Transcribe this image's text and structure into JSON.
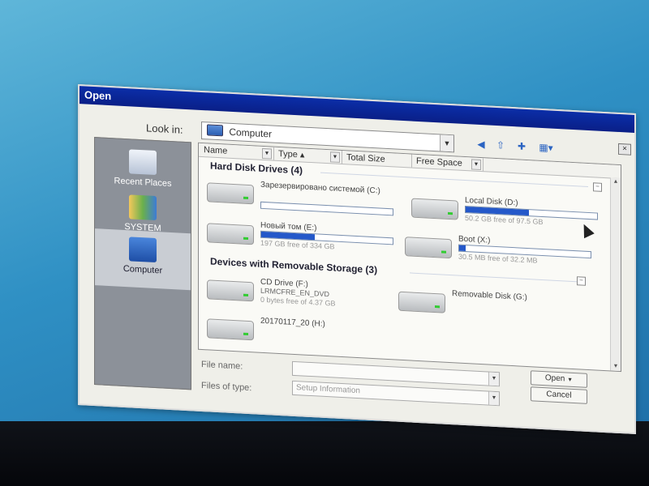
{
  "window": {
    "title": "Open",
    "close_glyph": "×"
  },
  "toolbar": {
    "lookin_label": "Look in:",
    "lookin_value": "Computer",
    "icons": [
      "back-icon",
      "up-folder-icon",
      "new-folder-icon",
      "views-icon"
    ]
  },
  "places": [
    {
      "label": "Recent Places"
    },
    {
      "label": "SYSTEM"
    },
    {
      "label": "Computer"
    }
  ],
  "columns": [
    "Name",
    "Type",
    "Total Size",
    "Free Space"
  ],
  "groups": {
    "hard": "Hard Disk Drives (4)",
    "removable": "Devices with Removable Storage (3)"
  },
  "drives": [
    {
      "name": "Зарезервировано системой (C:)",
      "free": "",
      "used_fraction": 0.0
    },
    {
      "name": "Local Disk (D:)",
      "free": "50.2 GB free of 97.5 GB",
      "used_fraction": 0.48
    },
    {
      "name": "Новый том (E:)",
      "free": "197 GB free of 334 GB",
      "used_fraction": 0.41
    },
    {
      "name": "Boot (X:)",
      "free": "30.5 MB free of 32.2 MB",
      "used_fraction": 0.05
    }
  ],
  "removable": [
    {
      "name": "CD Drive (F:)",
      "label": "LRMCFRE_EN_DVD",
      "free": "0 bytes free of 4.37 GB"
    },
    {
      "name": "Removable Disk (G:)",
      "label": "",
      "free": ""
    },
    {
      "name": "20170117_20 (H:)",
      "label": "",
      "free": ""
    }
  ],
  "footer": {
    "filename_label": "File name:",
    "filename_value": "",
    "filetype_label": "Files of type:",
    "filetype_value": "Setup Information",
    "open_label": "Open",
    "cancel_label": "Cancel"
  }
}
